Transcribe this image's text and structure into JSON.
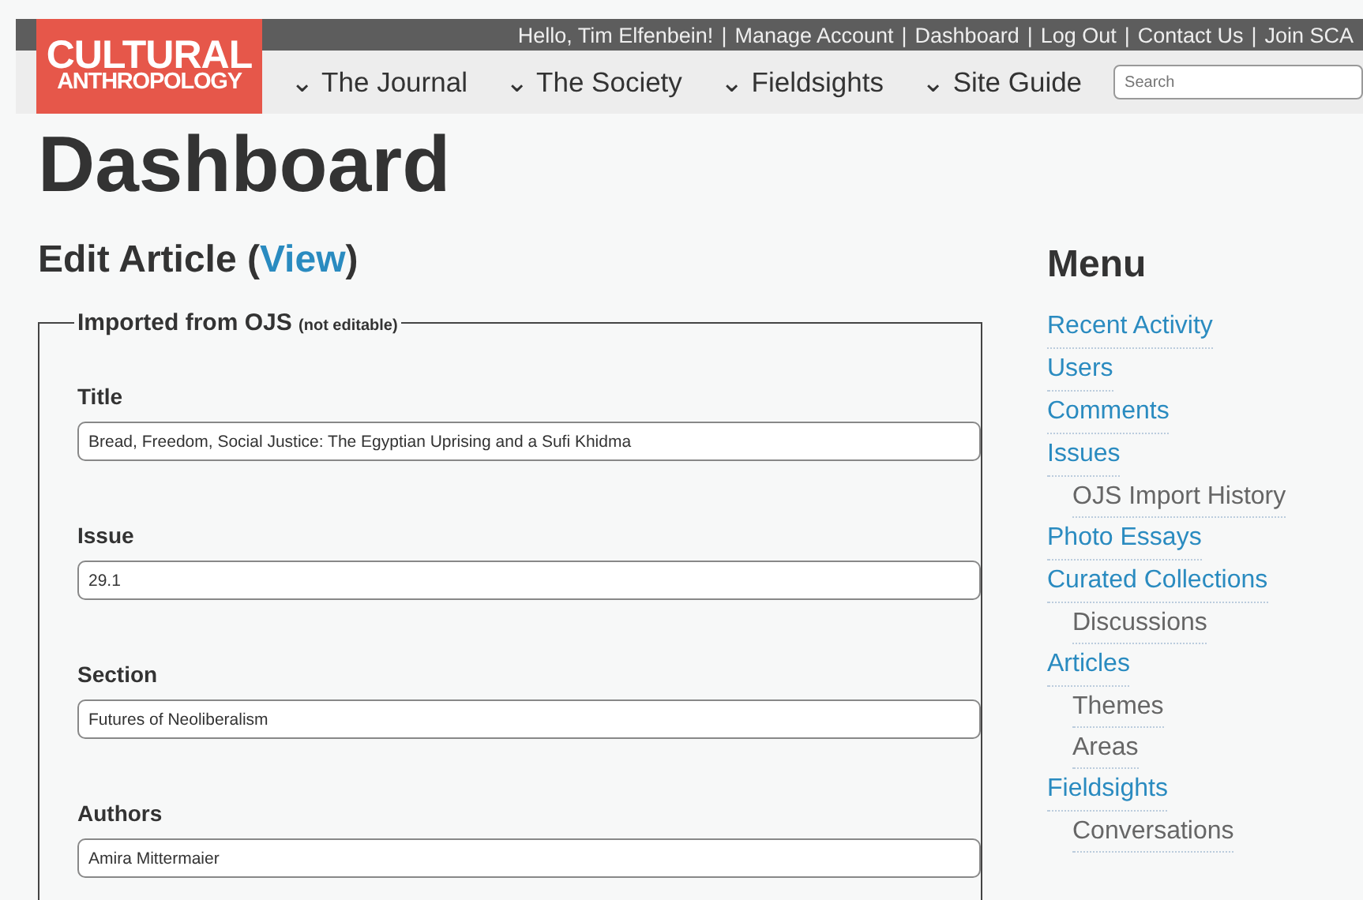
{
  "top_bar": {
    "greeting": "Hello, Tim Elfenbein!",
    "links": [
      "Manage Account",
      "Dashboard",
      "Log Out",
      "Contact Us",
      "Join SCA"
    ],
    "separator": "|"
  },
  "logo": {
    "line1": "CULTURAL",
    "line2": "ANTHROPOLOGY"
  },
  "nav": {
    "caret": "⌄",
    "items": [
      "The Journal",
      "The Society",
      "Fieldsights",
      "Site Guide"
    ],
    "search": {
      "placeholder": "Search"
    }
  },
  "page_title": "Dashboard",
  "heading": {
    "text": "Edit Article",
    "open": "(",
    "link": "View",
    "close": ")"
  },
  "fieldset": {
    "legend": "Imported from OJS",
    "note": "(not editable)",
    "fields": [
      {
        "label": "Title",
        "value": "Bread, Freedom, Social Justice: The Egyptian Uprising and a Sufi Khidma"
      },
      {
        "label": "Issue",
        "value": "29.1"
      },
      {
        "label": "Section",
        "value": "Futures of Neoliberalism"
      },
      {
        "label": "Authors",
        "value": "Amira Mittermaier"
      }
    ]
  },
  "menu": {
    "title": "Menu",
    "items": [
      {
        "label": "Recent Activity"
      },
      {
        "label": "Users"
      },
      {
        "label": "Comments"
      },
      {
        "label": "Issues",
        "children": [
          {
            "label": "OJS Import History"
          }
        ]
      },
      {
        "label": "Photo Essays"
      },
      {
        "label": "Curated Collections",
        "children": [
          {
            "label": "Discussions"
          }
        ]
      },
      {
        "label": "Articles",
        "children": [
          {
            "label": "Themes"
          },
          {
            "label": "Areas"
          }
        ]
      },
      {
        "label": "Fieldsights",
        "children": [
          {
            "label": "Conversations"
          }
        ]
      }
    ]
  }
}
